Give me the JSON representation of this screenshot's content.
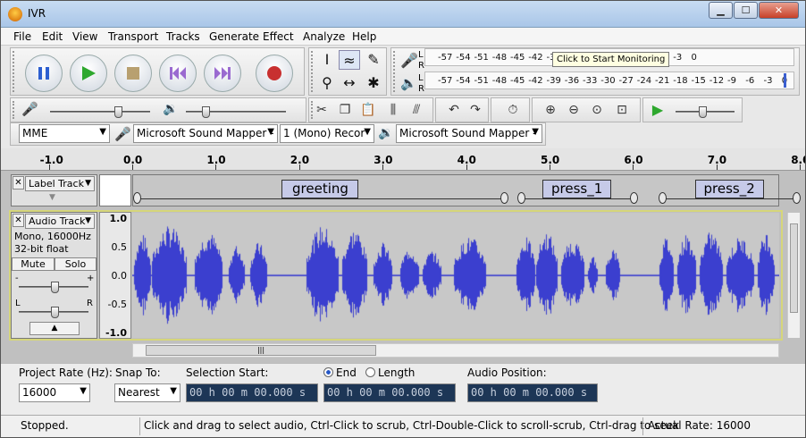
{
  "window": {
    "title": "IVR",
    "min_label": "▁",
    "max_label": "☐",
    "close_label": "✕"
  },
  "menu": [
    "File",
    "Edit",
    "View",
    "Transport",
    "Tracks",
    "Generate",
    "Effect",
    "Analyze",
    "Help"
  ],
  "meters": {
    "record_scale": [
      "-57",
      "-54",
      "-51",
      "-48",
      "-45",
      "-42",
      "-3",
      "-21",
      "-18",
      "-15",
      "-12",
      "-9",
      "-6",
      "-3",
      "0"
    ],
    "play_scale": [
      "-57",
      "-54",
      "-51",
      "-48",
      "-45",
      "-42",
      "-39",
      "-36",
      "-33",
      "-30",
      "-27",
      "-24",
      "-21",
      "-18",
      "-15",
      "-12",
      "-9",
      "-6",
      "-3",
      "0"
    ],
    "channel_left": "L",
    "channel_right": "R",
    "tooltip": "Click to Start Monitoring"
  },
  "device": {
    "host": "MME",
    "input": "Microsoft Sound Mapper -",
    "channels": "1 (Mono) Recor",
    "output": "Microsoft Sound Mapper -"
  },
  "ruler": [
    "-1.0",
    "0.0",
    "1.0",
    "2.0",
    "3.0",
    "4.0",
    "5.0",
    "6.0",
    "7.0",
    "8.0"
  ],
  "label_track": {
    "name": "Label Track",
    "labels": [
      {
        "text": "greeting",
        "start": 0.0,
        "end": 4.4
      },
      {
        "text": "press_1",
        "start": 4.6,
        "end": 5.95
      },
      {
        "text": "press_2",
        "start": 6.3,
        "end": 7.9
      }
    ]
  },
  "audio_track": {
    "name": "Audio Track",
    "info1": "Mono, 16000Hz",
    "info2": "32-bit float",
    "mute": "Mute",
    "solo": "Solo",
    "gain_minus": "-",
    "gain_plus": "+",
    "pan_left": "L",
    "pan_right": "R",
    "scale": [
      "1.0",
      "0.5",
      "0.0",
      "-0.5",
      "-1.0"
    ]
  },
  "selection": {
    "project_rate_label": "Project Rate (Hz):",
    "project_rate": "16000",
    "snap_label": "Snap To:",
    "snap_value": "Nearest",
    "start_label": "Selection Start:",
    "end_label": "End",
    "length_label": "Length",
    "position_label": "Audio Position:",
    "start_value": "00 h 00 m 00.000 s",
    "end_value": "00 h 00 m 00.000 s",
    "position_value": "00 h 00 m 00.000 s"
  },
  "status": {
    "state": "Stopped.",
    "hint": "Click and drag to select audio, Ctrl-Click to scrub, Ctrl-Double-Click to scroll-scrub, Ctrl-drag to seek",
    "rate": "Actual Rate: 16000"
  },
  "colors": {
    "waveform": "#3b3fcf",
    "label_fill": "#c6cae8",
    "track_bg": "#c8c8c8"
  }
}
